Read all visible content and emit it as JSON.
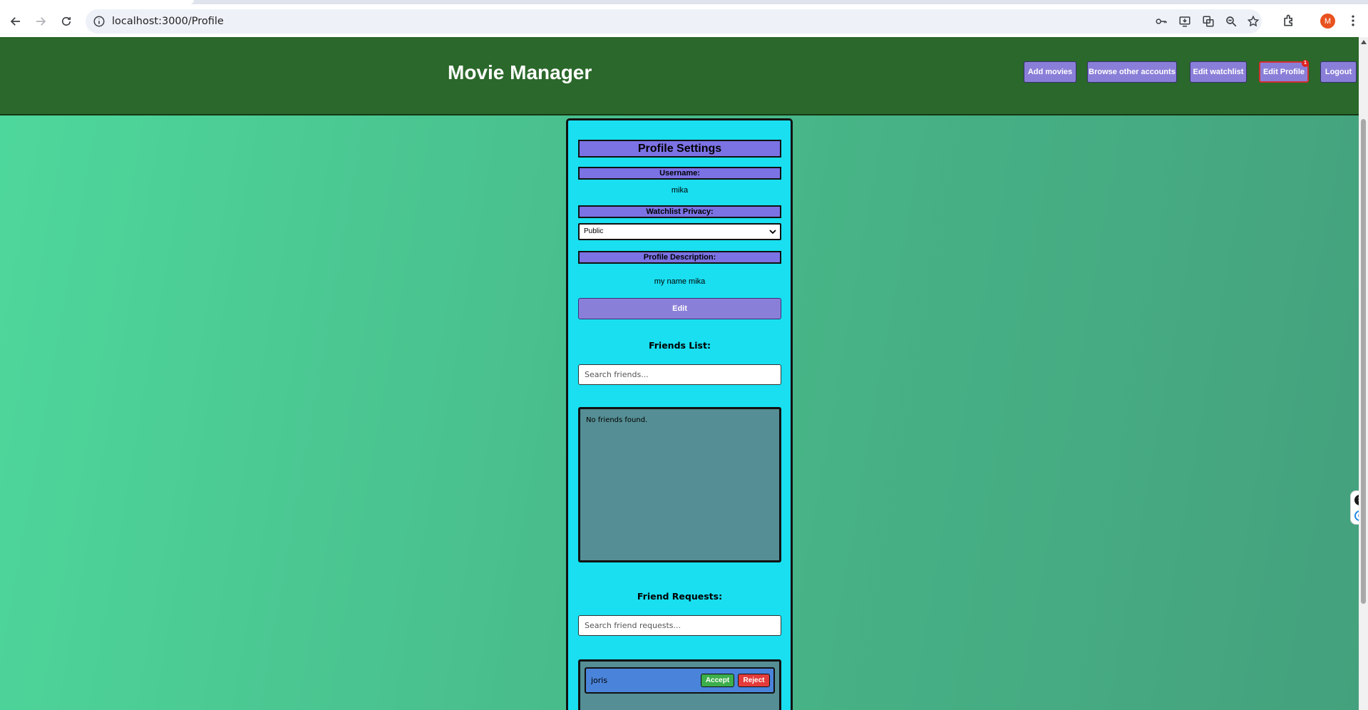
{
  "browser": {
    "url": "localhost:3000/Profile",
    "profile_initial": "M"
  },
  "header": {
    "title": "Movie Manager",
    "nav": {
      "add_movies": "Add movies",
      "browse_accounts": "Browse other accounts",
      "edit_watchlist": "Edit watchlist",
      "edit_profile": "Edit Profile",
      "edit_profile_badge": "1",
      "logout": "Logout"
    }
  },
  "profile": {
    "title": "Profile Settings",
    "username_label": "Username:",
    "username_value": "mika",
    "privacy_label": "Watchlist Privacy:",
    "privacy_selected": "Public",
    "description_label": "Profile Description:",
    "description_value": "my name mika",
    "edit_button": "Edit"
  },
  "friends": {
    "heading": "Friends List:",
    "search_placeholder": "Search friends...",
    "empty_message": "No friends found."
  },
  "requests": {
    "heading": "Friend Requests:",
    "search_placeholder": "Search friend requests...",
    "items": [
      {
        "name": "joris",
        "accept_label": "Accept",
        "reject_label": "Reject"
      }
    ]
  },
  "colors": {
    "header_bg": "#2b682b",
    "panel_bg": "#19dff0",
    "accent_purple": "#8a7fd8",
    "accept_green": "#3cae4b",
    "reject_red": "#e43b3b"
  }
}
